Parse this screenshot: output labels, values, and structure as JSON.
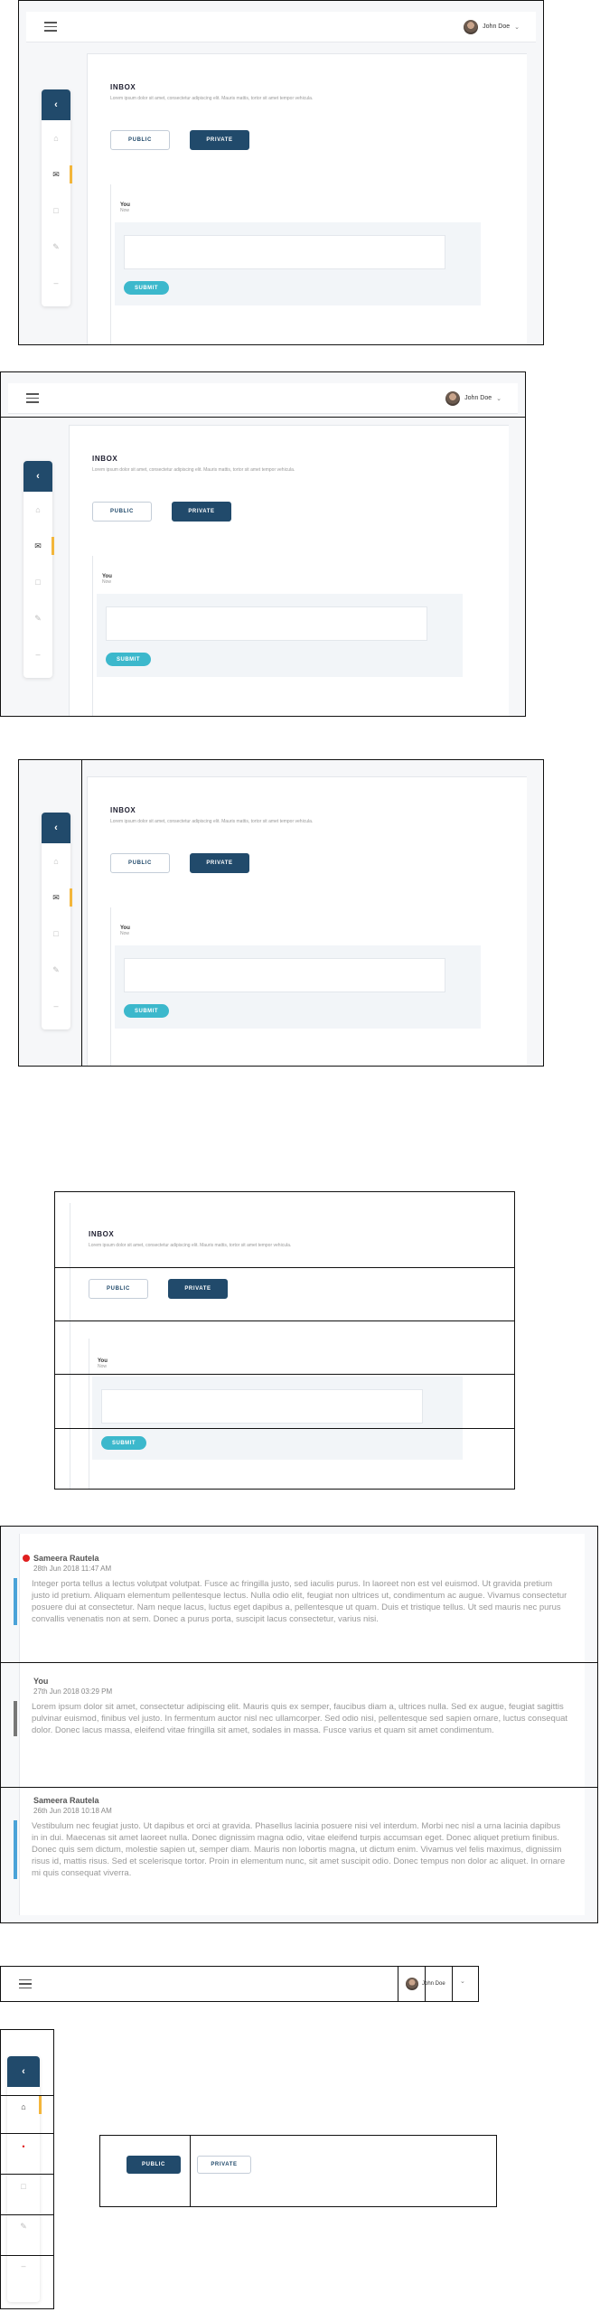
{
  "header": {
    "user_name": "John Doe"
  },
  "inbox": {
    "title": "INBOX",
    "subtitle": "Lorem ipsum dolor sit amet, consectetur adipiscing elit. Mauris mattis, tortor sit amet tempor vehicula.",
    "public_label": "PUBLIC",
    "private_label": "PRIVATE",
    "compose_author": "You",
    "compose_time": "Now",
    "submit_label": "SUBMIT"
  },
  "messages": [
    {
      "author": "Sameera Rautela",
      "date": "28th Jun 2018 11:47 AM",
      "unread": true,
      "bar_color": "#4aa3d8",
      "body": "Integer porta tellus a lectus volutpat volutpat. Fusce ac fringilla justo, sed iaculis purus. In laoreet non est vel euismod. Ut gravida pretium justo id pretium. Aliquam elementum pellentesque lectus. Nulla odio elit, feugiat non ultrices ut, condimentum ac augue. Vivamus consectetur posuere dui at consectetur. Nam neque lacus, luctus eget dapibus a, pellentesque ut quam. Duis et tristique tellus. Ut sed mauris nec purus convallis venenatis non at sem. Donec a purus porta, suscipit lacus consectetur, varius nisi."
    },
    {
      "author": "You",
      "date": "27th Jun 2018 03:29 PM",
      "unread": false,
      "bar_color": "#777777",
      "body": "Lorem ipsum dolor sit amet, consectetur adipiscing elit. Mauris quis ex semper, faucibus diam a, ultrices nulla. Sed ex augue, feugiat sagittis pulvinar euismod, finibus vel justo. In fermentum auctor nisl nec ullamcorper. Sed odio nisi, pellentesque sed sapien ornare, luctus consequat dolor. Donec lacus massa, eleifend vitae fringilla sit amet, sodales in massa. Fusce varius et quam sit amet condimentum."
    },
    {
      "author": "Sameera Rautela",
      "date": "26th Jun 2018 10:18 AM",
      "unread": false,
      "bar_color": "#4aa3d8",
      "body": "Vestibulum nec feugiat justo. Ut dapibus et orci at gravida. Phasellus lacinia posuere nisi vel interdum. Morbi nec nisl a urna lacinia dapibus in in dui. Maecenas sit amet laoreet nulla. Donec dignissim magna odio, vitae eleifend turpis accumsan eget. Donec aliquet pretium finibus. Donec quis sem dictum, molestie sapien ut, semper diam. Mauris non lobortis magna, ut dictum enim. Vivamus vel felis maximus, dignissim risus id, mattis risus. Sed et scelerisque tortor. Proin in elementum nunc, sit amet suscipit odio. Donec tempus non dolor ac aliquet. In ornare mi quis consequat viverra."
    }
  ],
  "icons": {
    "nav": [
      "home-icon",
      "inbox-icon",
      "calendar-icon",
      "edit-icon",
      "link-icon"
    ]
  },
  "colors": {
    "primary": "#214a6b",
    "accent": "#3cb8cc",
    "active": "#f3b63b",
    "unread": "#e02020"
  }
}
